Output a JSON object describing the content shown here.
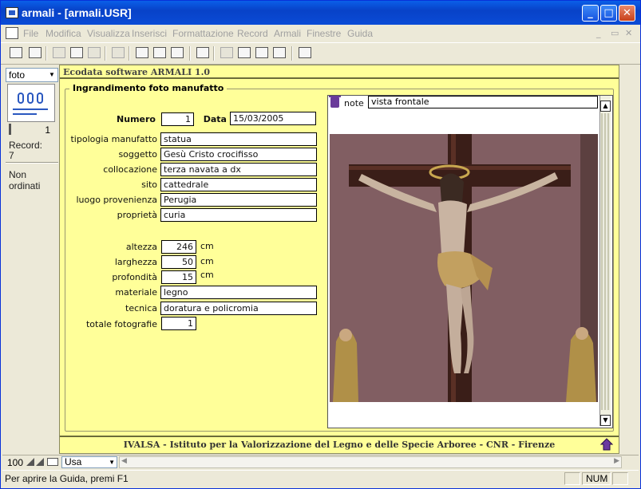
{
  "window": {
    "title": "armali - [armali.USR]"
  },
  "menu": [
    "File",
    "Modifica",
    "Visualizza",
    "Inserisci",
    "Formattazione",
    "Record",
    "Armali",
    "Finestre",
    "Guida"
  ],
  "left_panel": {
    "layout": "foto",
    "record_slider_value": "1",
    "record_label": "Record:",
    "record_count": "7",
    "sort_status": "Non ordinati"
  },
  "app_header": "Ecodata software ARMALI 1.0",
  "form": {
    "group_title": "Ingrandimento foto manufatto",
    "numero_label": "Numero",
    "numero": "1",
    "data_label": "Data",
    "data": "15/03/2005",
    "fields": [
      {
        "label": "tipologia manufatto",
        "value": "statua"
      },
      {
        "label": "soggetto",
        "value": "Gesù Cristo crocifisso"
      },
      {
        "label": "collocazione",
        "value": "terza navata a dx"
      },
      {
        "label": "sito",
        "value": "cattedrale"
      },
      {
        "label": "luogo provenienza",
        "value": "Perugia"
      },
      {
        "label": "proprietà",
        "value": "curia"
      }
    ],
    "dimensions": [
      {
        "label": "altezza",
        "value": "246",
        "unit": "cm"
      },
      {
        "label": "larghezza",
        "value": "50",
        "unit": "cm"
      },
      {
        "label": "profondità",
        "value": "15",
        "unit": "cm"
      }
    ],
    "materiale_label": "materiale",
    "materiale": "legno",
    "tecnica_label": "tecnica",
    "tecnica": "doratura e policromia",
    "totale_label": "totale fotografie",
    "totale": "1",
    "note_label": "note",
    "note": "vista frontale"
  },
  "footer": "IVALSA - Istituto per la Valorizzazione del Legno e delle Specie Arboree - CNR - Firenze",
  "bottom": {
    "zoom": "100",
    "mode": "Usa"
  },
  "status": {
    "text": "Per aprire la Guida, premi F1",
    "num": "NUM"
  }
}
